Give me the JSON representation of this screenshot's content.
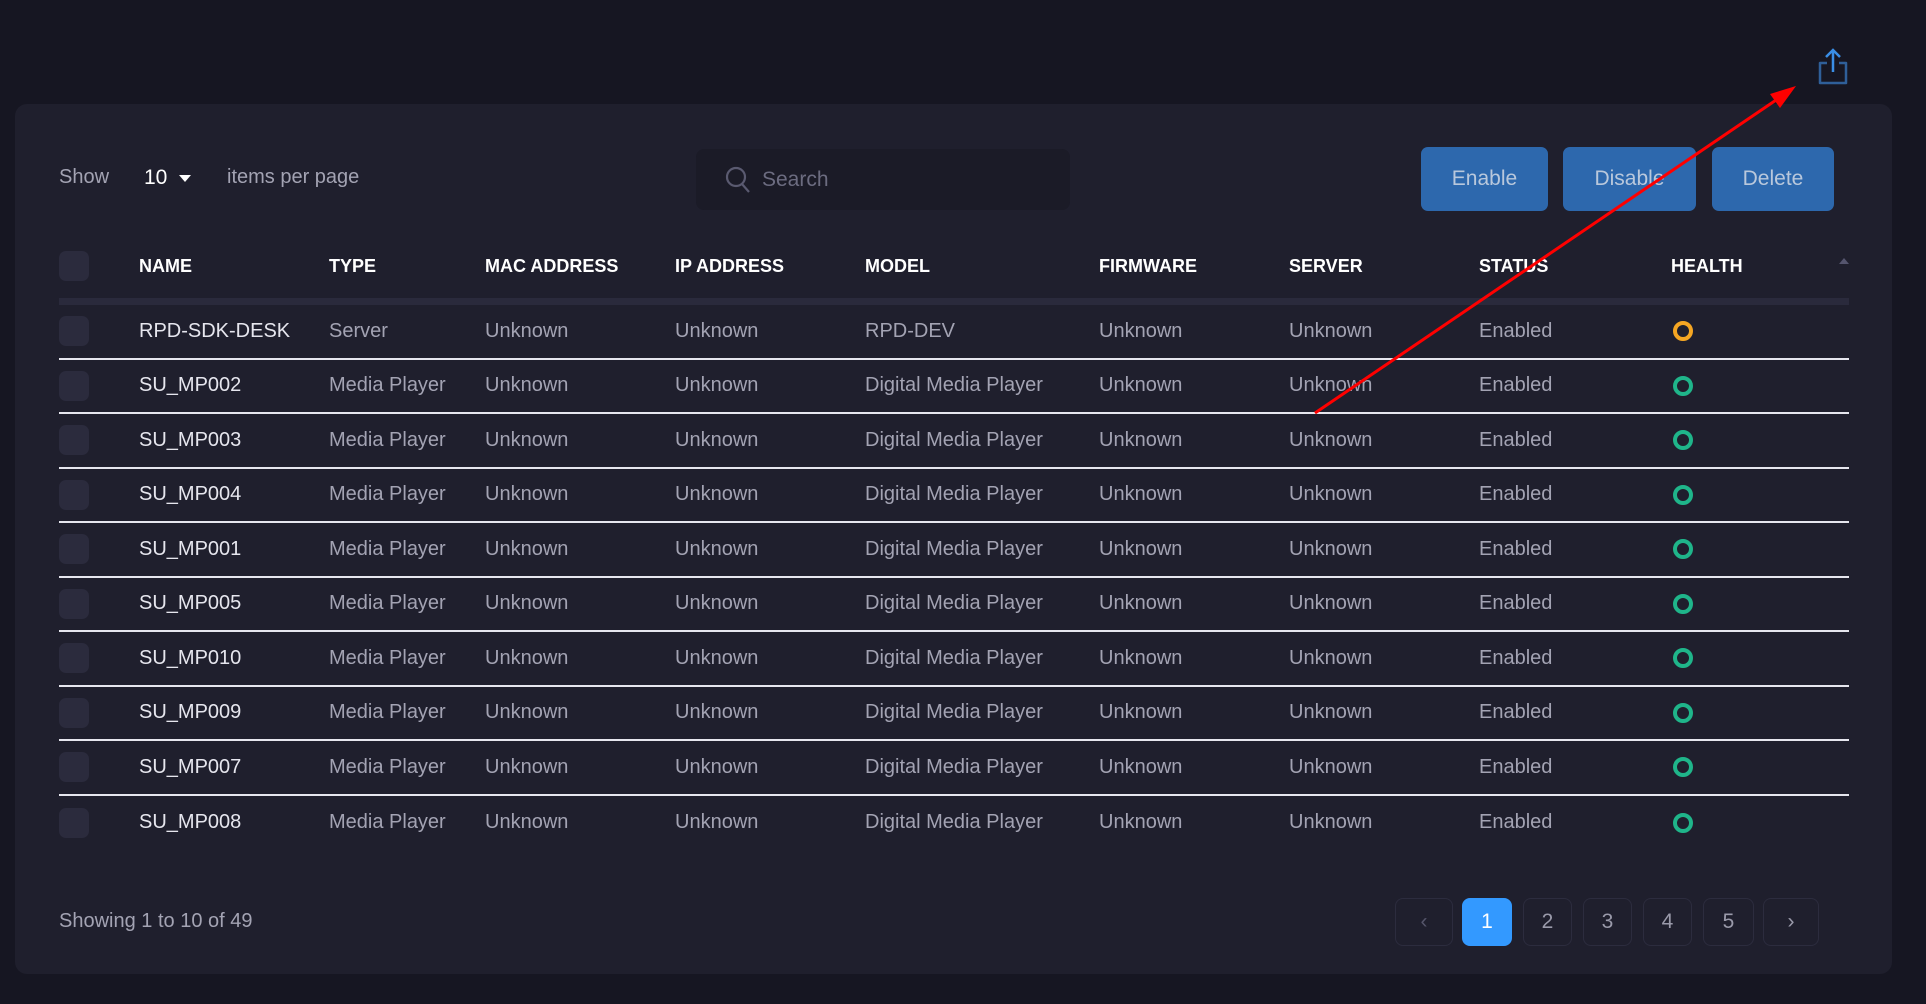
{
  "toolbar": {
    "show_label": "Show",
    "per_page_value": "10",
    "items_per_page_label": "items per page",
    "search_placeholder": "Search",
    "enable_label": "Enable",
    "disable_label": "Disable",
    "delete_label": "Delete"
  },
  "table": {
    "columns": [
      "NAME",
      "TYPE",
      "MAC ADDRESS",
      "IP ADDRESS",
      "MODEL",
      "FIRMWARE",
      "SERVER",
      "STATUS",
      "HEALTH"
    ],
    "rows": [
      {
        "name": "RPD-SDK-DESK",
        "type": "Server",
        "mac": "Unknown",
        "ip": "Unknown",
        "model": "RPD-DEV",
        "firmware": "Unknown",
        "server": "Unknown",
        "status": "Enabled",
        "health": "warning"
      },
      {
        "name": "SU_MP002",
        "type": "Media Player",
        "mac": "Unknown",
        "ip": "Unknown",
        "model": "Digital Media Player",
        "firmware": "Unknown",
        "server": "Unknown",
        "status": "Enabled",
        "health": "healthy"
      },
      {
        "name": "SU_MP003",
        "type": "Media Player",
        "mac": "Unknown",
        "ip": "Unknown",
        "model": "Digital Media Player",
        "firmware": "Unknown",
        "server": "Unknown",
        "status": "Enabled",
        "health": "healthy"
      },
      {
        "name": "SU_MP004",
        "type": "Media Player",
        "mac": "Unknown",
        "ip": "Unknown",
        "model": "Digital Media Player",
        "firmware": "Unknown",
        "server": "Unknown",
        "status": "Enabled",
        "health": "healthy"
      },
      {
        "name": "SU_MP001",
        "type": "Media Player",
        "mac": "Unknown",
        "ip": "Unknown",
        "model": "Digital Media Player",
        "firmware": "Unknown",
        "server": "Unknown",
        "status": "Enabled",
        "health": "healthy"
      },
      {
        "name": "SU_MP005",
        "type": "Media Player",
        "mac": "Unknown",
        "ip": "Unknown",
        "model": "Digital Media Player",
        "firmware": "Unknown",
        "server": "Unknown",
        "status": "Enabled",
        "health": "healthy"
      },
      {
        "name": "SU_MP010",
        "type": "Media Player",
        "mac": "Unknown",
        "ip": "Unknown",
        "model": "Digital Media Player",
        "firmware": "Unknown",
        "server": "Unknown",
        "status": "Enabled",
        "health": "healthy"
      },
      {
        "name": "SU_MP009",
        "type": "Media Player",
        "mac": "Unknown",
        "ip": "Unknown",
        "model": "Digital Media Player",
        "firmware": "Unknown",
        "server": "Unknown",
        "status": "Enabled",
        "health": "healthy"
      },
      {
        "name": "SU_MP007",
        "type": "Media Player",
        "mac": "Unknown",
        "ip": "Unknown",
        "model": "Digital Media Player",
        "firmware": "Unknown",
        "server": "Unknown",
        "status": "Enabled",
        "health": "healthy"
      },
      {
        "name": "SU_MP008",
        "type": "Media Player",
        "mac": "Unknown",
        "ip": "Unknown",
        "model": "Digital Media Player",
        "firmware": "Unknown",
        "server": "Unknown",
        "status": "Enabled",
        "health": "healthy"
      }
    ]
  },
  "footer": {
    "showing_text": "Showing 1 to 10 of 49"
  },
  "pagination": {
    "pages": [
      "1",
      "2",
      "3",
      "4",
      "5"
    ],
    "current": "1"
  },
  "colors": {
    "accent": "#3399ff",
    "button": "#2d68ad",
    "healthy": "#1fb58a",
    "warning": "#f5a623",
    "annotation": "#ff0000"
  },
  "icons": {
    "export": "share-export-icon",
    "search": "search-icon"
  }
}
